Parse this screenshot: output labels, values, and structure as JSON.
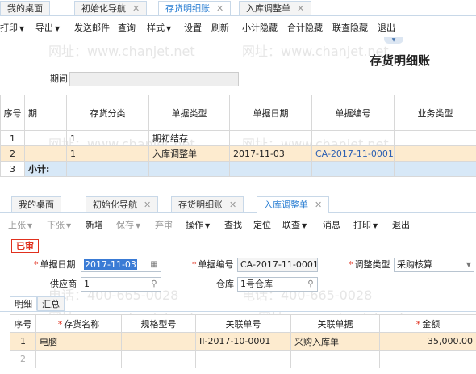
{
  "top_tabs": [
    {
      "label": "我的桌面",
      "closable": false,
      "active": false
    },
    {
      "label": "初始化导航",
      "closable": true,
      "active": false
    },
    {
      "label": "存货明细账",
      "closable": true,
      "active": true
    },
    {
      "label": "入库调整单",
      "closable": true,
      "active": false
    }
  ],
  "top_toolbar": [
    "打印",
    "导出",
    "发送邮件",
    "查询",
    "样式",
    "设置",
    "刷新",
    "小计隐藏",
    "合计隐藏",
    "联查隐藏",
    "退出"
  ],
  "report": {
    "title": "存货明细账",
    "period_label": "期间",
    "period_value": "",
    "columns": [
      "序号",
      "期",
      "存货分类",
      "单据类型",
      "单据日期",
      "单据编号",
      "业务类型"
    ],
    "rows": [
      {
        "no": "1",
        "period": "",
        "category": "1",
        "doc_type": "期初结存",
        "doc_date": "",
        "doc_no": "",
        "biz_type": ""
      },
      {
        "no": "2",
        "period": "",
        "category": "1",
        "doc_type": "入库调整单",
        "doc_date": "2017-11-03",
        "doc_no": "CA-2017-11-0001",
        "biz_type": ""
      },
      {
        "no": "3",
        "period": "小计:",
        "category": "",
        "doc_type": "",
        "doc_date": "",
        "doc_no": "",
        "biz_type": ""
      }
    ]
  },
  "bottom_tabs": [
    {
      "label": "我的桌面",
      "closable": false,
      "active": false
    },
    {
      "label": "初始化导航",
      "closable": true,
      "active": false
    },
    {
      "label": "存货明细账",
      "closable": true,
      "active": false
    },
    {
      "label": "入库调整单",
      "closable": true,
      "active": true
    }
  ],
  "bottom_toolbar": [
    {
      "label": "上张",
      "caret": true,
      "disabled": true
    },
    {
      "label": "下张",
      "caret": true,
      "disabled": true
    },
    {
      "label": "新增",
      "caret": false,
      "disabled": false
    },
    {
      "label": "保存",
      "caret": true,
      "disabled": true
    },
    {
      "label": "弃审",
      "caret": false,
      "disabled": true
    },
    {
      "label": "操作",
      "caret": true,
      "disabled": false
    },
    {
      "label": "查找",
      "caret": false,
      "disabled": false
    },
    {
      "label": "定位",
      "caret": false,
      "disabled": false
    },
    {
      "label": "联查",
      "caret": true,
      "disabled": false
    },
    {
      "label": "消息",
      "caret": false,
      "disabled": false
    },
    {
      "label": "打印",
      "caret": true,
      "disabled": false
    },
    {
      "label": "退出",
      "caret": false,
      "disabled": false
    }
  ],
  "form": {
    "status_stamp": "已审",
    "doc_date_label": "单据日期",
    "doc_date_value": "2017-11-03",
    "doc_no_label": "单据编号",
    "doc_no_value": "CA-2017-11-0001",
    "adjust_type_label": "调整类型",
    "adjust_type_value": "采购核算",
    "supplier_label": "供应商",
    "supplier_value": "1",
    "warehouse_label": "仓库",
    "warehouse_value": "1号仓库"
  },
  "detail_tabs": [
    "明细",
    "汇总"
  ],
  "detail": {
    "columns": [
      "序号",
      "存货名称",
      "规格型号",
      "关联单号",
      "关联单据",
      "金额"
    ],
    "rows": [
      {
        "no": "1",
        "name": "电脑",
        "spec": "",
        "ref_no": "II-2017-10-0001",
        "ref_doc": "采购入库单",
        "amount": "35,000.00"
      },
      {
        "no": "2",
        "name": "",
        "spec": "",
        "ref_no": "",
        "ref_doc": "",
        "amount": ""
      }
    ]
  },
  "watermarks": [
    "网址：www.chanjet.net",
    "电话：400-665-0028"
  ],
  "colors": {
    "accent": "#2b7fd3",
    "highlight_row": "#fdebcf",
    "subtotal_row": "#d7e8f7",
    "stamp": "#e0301e"
  }
}
